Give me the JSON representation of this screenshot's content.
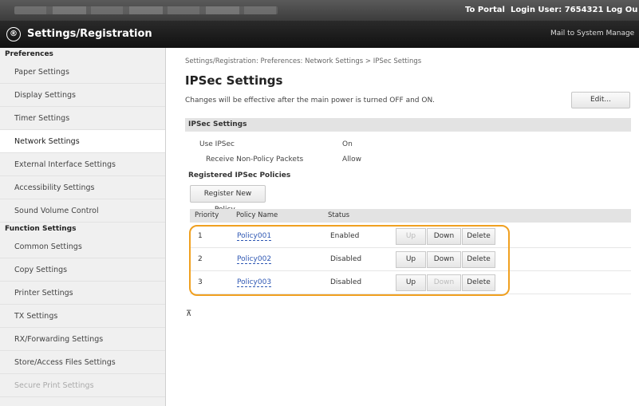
{
  "topbar": {
    "portal_label": "To Portal",
    "login_label": "Login User:  7654321  Log Ou"
  },
  "titlebar": {
    "logo_glyph": "®",
    "title": "Settings/Registration",
    "mail_label": "Mail to System Manage"
  },
  "sidebar": {
    "section1": "Preferences",
    "items1": [
      "Paper Settings",
      "Display Settings",
      "Timer Settings",
      "Network Settings",
      "External Interface Settings",
      "Accessibility Settings",
      "Sound Volume Control"
    ],
    "section2": "Function Settings",
    "items2": [
      "Common Settings",
      "Copy Settings",
      "Printer Settings",
      "TX Settings",
      "RX/Forwarding Settings",
      "Store/Access Files Settings",
      "Secure Print Settings"
    ]
  },
  "main": {
    "breadcrumb": "Settings/Registration: Preferences: Network Settings > IPSec Settings",
    "title": "IPSec Settings",
    "notice": "Changes will be effective after the main power is turned OFF and ON.",
    "edit_label": "Edit...",
    "section_title": "IPSec Settings",
    "use_ipsec_label": "Use IPSec",
    "use_ipsec_value": "On",
    "receive_label": "Receive Non-Policy Packets",
    "receive_value": "Allow",
    "registered_title": "Registered IPSec Policies",
    "register_button": "Register New Policy...",
    "columns": [
      "Priority",
      "Policy Name",
      "Status"
    ],
    "rows": [
      {
        "priority": "1",
        "name": "Policy001",
        "status": "Enabled",
        "up_enabled": false,
        "down_enabled": true
      },
      {
        "priority": "2",
        "name": "Policy002",
        "status": "Disabled",
        "up_enabled": true,
        "down_enabled": true
      },
      {
        "priority": "3",
        "name": "Policy003",
        "status": "Disabled",
        "up_enabled": true,
        "down_enabled": false
      }
    ],
    "up_label": "Up",
    "down_label": "Down",
    "delete_label": "Delete",
    "to_top_glyph": "⊼"
  },
  "colors": {
    "highlight": "#f0a020",
    "link": "#2e57b3",
    "header_bg": "#111111"
  }
}
